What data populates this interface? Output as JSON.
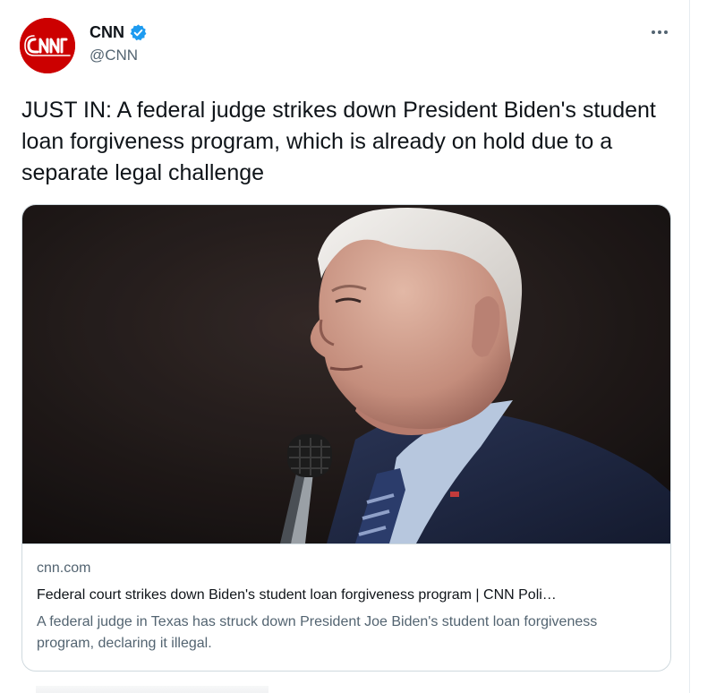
{
  "account": {
    "display_name": "CNN",
    "handle": "@CNN",
    "avatar_logo_text": "CNN",
    "verified": true
  },
  "tweet": {
    "text": "JUST IN: A federal judge strikes down President Biden's student loan forgiveness program, which is already on hold due to a separate legal challenge"
  },
  "card": {
    "domain": "cnn.com",
    "title": "Federal court strikes down Biden's student loan forgiveness program | CNN Poli…",
    "description": "A federal judge in Texas has struck down President Joe Biden's student loan forgiveness program, declaring it illegal."
  },
  "icons": {
    "verified": "verified-badge-icon",
    "more": "more-options-icon"
  },
  "colors": {
    "brand": "#cc0000",
    "verified": "#1d9bf0",
    "text_primary": "#0f1419",
    "text_secondary": "#536471",
    "border": "#cfd9de"
  }
}
